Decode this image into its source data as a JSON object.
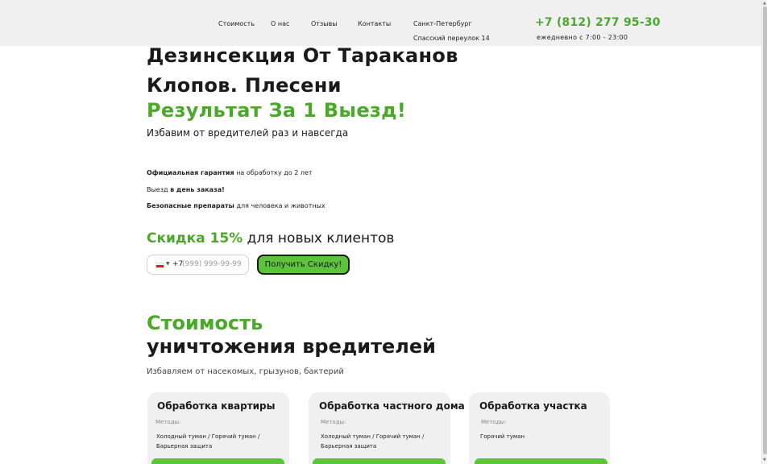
{
  "header": {
    "nav": [
      "Стоимость",
      "О нас",
      "Отзывы",
      "Контакты"
    ],
    "city": "Санкт-Петербург",
    "address": "Спасский переулок 14",
    "phone": "+7 (812) 277 95-30",
    "hours": "ежедневно с 7:00 - 23:00"
  },
  "hero": {
    "title_line1": "Дезинсекция От Тараканов",
    "title_line2": "Клопов. Плесени",
    "title_green": "Результат За 1 Выезд!",
    "subtitle": "Избавим от вредителей раз и навсегда",
    "features": [
      {
        "bold": "Официальная гарантия",
        "rest": " на обработку до 2 лет",
        "bold_first": true
      },
      {
        "pre": "Выезд ",
        "bold": "в день заказа!",
        "bold_first": false
      },
      {
        "bold": "Безопасные препараты",
        "rest": " для человека и животных",
        "bold_first": true
      }
    ],
    "discount_green": "Скидка 15%",
    "discount_rest": " для новых клиентов",
    "phone_prefix": "+7",
    "phone_placeholder": "(999) 999-99-99",
    "cta_label": "Получить Скидку!"
  },
  "pricing": {
    "title_green": "Стоимость",
    "title_dark": "уничтожения вредителей",
    "subtitle": "Избавляем от насекомых, грызунов, бактерий",
    "cards": [
      {
        "title": "Обработка квартиры",
        "methods_label": "Методы:",
        "methods": "Холодный туман / Горячий туман / Барьерная защита"
      },
      {
        "title": "Обработка частного дома",
        "methods_label": "Методы:",
        "methods": "Холодный туман / Горячий туман / Барьерная защита"
      },
      {
        "title": "Обработка участка",
        "methods_label": "Методы:",
        "methods": "Горячий туман"
      }
    ]
  },
  "colors": {
    "accent": "#4aa82a",
    "button": "#5cc33a",
    "header_bg": "#f0f0f0",
    "card_bg": "#f0f0f0"
  },
  "icons": {
    "flag": "russia-flag-icon",
    "caret": "chevron-down-icon"
  }
}
